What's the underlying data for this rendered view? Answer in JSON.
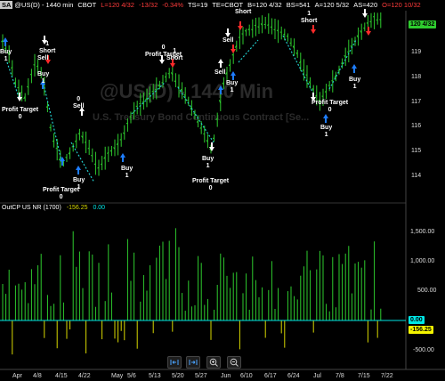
{
  "header": {
    "symbol_badge": "SA",
    "symbol": "@US(D) - 1440 min",
    "exchange": "CBOT",
    "last": "L=120 4/32",
    "change": "-13/32",
    "change_pct": "-0.34%",
    "ts": "TS=19",
    "te": "TE=CBOT",
    "bid": "B=120 4/32",
    "bid_size": "BS=541",
    "ask": "A=120 5/32",
    "ask_size": "AS=420",
    "open": "O=120 10/32"
  },
  "watermark": {
    "line1": "@US(D) - 1440 Min",
    "line2": "U.S. Treasury Bond Continuous Contract [Se..."
  },
  "price_axis": {
    "current_tag": "120 4/32",
    "ticks": [
      "119",
      "118",
      "117",
      "116",
      "115",
      "114"
    ]
  },
  "indicator": {
    "title": "OutCP US NR (1700)",
    "value1": "-156.25",
    "value2": "0.00",
    "ticks": [
      "1,500.00",
      "1,000.00",
      "500.00",
      "-500.00"
    ],
    "zero_tag": "0.00",
    "value_tag": "-156.25"
  },
  "dates": [
    "Apr",
    "4/8",
    "4/15",
    "4/22",
    "May",
    "5/6",
    "5/13",
    "5/20",
    "5/27",
    "Jun",
    "6/10",
    "6/17",
    "6/24",
    "Jul",
    "7/8",
    "7/15",
    "7/22"
  ],
  "annotations": [
    {
      "l1": "Buy",
      "l2": "1"
    },
    {
      "l1": "Profit Target",
      "l2": "0"
    },
    {
      "l1": "1",
      "l2": "Short"
    },
    {
      "l1": "Sell",
      "l2": ""
    },
    {
      "l1": "Buy",
      "l2": "1"
    },
    {
      "l1": "0",
      "l2": "Sell"
    },
    {
      "l1": "Profit Target",
      "l2": "0"
    },
    {
      "l1": "Buy",
      "l2": "1"
    },
    {
      "l1": "0",
      "l2": "Profit Target"
    },
    {
      "l1": "1",
      "l2": "Short"
    },
    {
      "l1": "Buy",
      "l2": "1"
    },
    {
      "l1": "Profit Target",
      "l2": "0"
    },
    {
      "l1": "Sell",
      "l2": ""
    },
    {
      "l1": "Buy",
      "l2": "1"
    },
    {
      "l1": "Sell",
      "l2": ""
    },
    {
      "l1": "0",
      "l2": "Profit Target"
    },
    {
      "l1": "Short",
      "l2": ""
    },
    {
      "l1": "Buy",
      "l2": "1"
    },
    {
      "l1": "1",
      "l2": "Short"
    },
    {
      "l1": "Profit Target",
      "l2": "0"
    },
    {
      "l1": "Buy",
      "l2": "1"
    },
    {
      "l1": "Buy",
      "l2": "1"
    },
    {
      "l1": "Short",
      "l2": ""
    }
  ],
  "toolbar": {
    "icons": [
      "compress-bars-icon",
      "expand-bars-icon",
      "zoom-in-icon",
      "zoom-out-icon"
    ]
  },
  "colors": {
    "bars": "#2ecc2e",
    "zero_line": "#00e6e6",
    "hist_pos": "#2ecc2e",
    "hist_neg": "#d8d800",
    "trend_line": "#22cccc",
    "up_arrow": "#1e7dff",
    "down_arrow": "#ff2a2a"
  }
}
